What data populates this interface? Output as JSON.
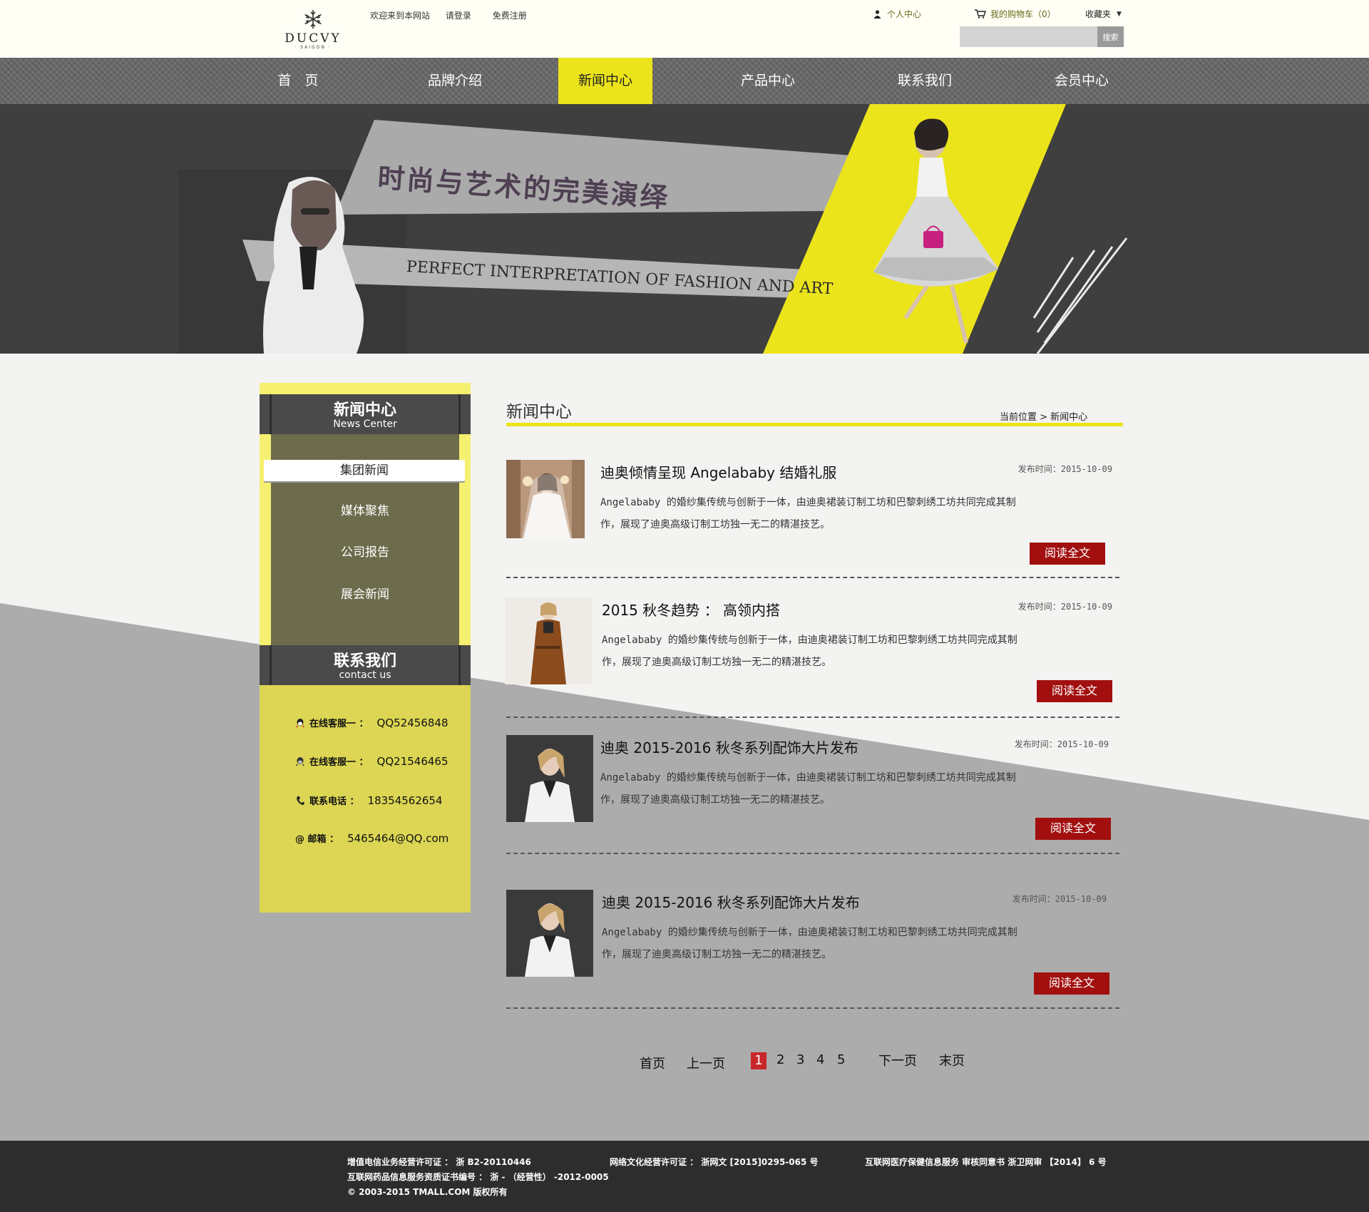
{
  "header": {
    "logo": {
      "brand": "DUCVY",
      "sub": "· SAIGON ·"
    },
    "welcome": "欢迎来到本网站",
    "login": "请登录",
    "register": "免费注册",
    "user_center": "个人中心",
    "cart": "我的购物车（0）",
    "favorites": "收藏夹",
    "search": {
      "placeholder": "",
      "button": "搜索"
    }
  },
  "nav": {
    "items": [
      {
        "label": "首　页"
      },
      {
        "label": "品牌介绍"
      },
      {
        "label": "新闻中心",
        "active": true
      },
      {
        "label": "产品中心"
      },
      {
        "label": "联系我们"
      },
      {
        "label": "会员中心"
      }
    ]
  },
  "banner": {
    "title": "时尚与艺术的完美演绎",
    "subtitle": "PERFECT INTERPRETATION OF FASHION AND ART"
  },
  "sidebar": {
    "news_head": {
      "title": "新闻中心",
      "subtitle": "News Center"
    },
    "menu": [
      {
        "label": "集团新闻",
        "active": true
      },
      {
        "label": "媒体聚焦"
      },
      {
        "label": "公司报告"
      },
      {
        "label": "展会新闻"
      }
    ],
    "contact_head": {
      "title": "联系我们",
      "subtitle": "contact us"
    },
    "contacts": [
      {
        "icon": "qq-icon",
        "label": "在线客服一 ：",
        "value": "QQ52456848"
      },
      {
        "icon": "qq-icon",
        "label": "在线客服一 ：",
        "value": "QQ21546465"
      },
      {
        "icon": "phone-icon",
        "label": "联系电话 ：",
        "value": "18354562654"
      },
      {
        "icon": "at-icon",
        "label": "@ 邮箱 ：",
        "value": "5465464@QQ.com"
      }
    ]
  },
  "content": {
    "title": "新闻中心",
    "breadcrumb": "当前位置 > 新闻中心",
    "news": [
      {
        "title": "迪奥倾情呈现 Angelababy 结婚礼服",
        "date": "发布时间：2015-10-09",
        "summary": "Angelababy 的婚纱集传统与创新于一体，由迪奥裙装订制工坊和巴黎刺绣工坊共同完成其制作，展现了迪奥高级订制工坊独一无二的精湛技艺。",
        "button": "阅读全文"
      },
      {
        "title": "2015 秋冬趋势 ： 高领内搭",
        "date": "发布时间：2015-10-09",
        "summary": "Angelababy 的婚纱集传统与创新于一体，由迪奥裙装订制工坊和巴黎刺绣工坊共同完成其制作，展现了迪奥高级订制工坊独一无二的精湛技艺。",
        "button": "阅读全文"
      },
      {
        "title": "迪奥 2015-2016 秋冬系列配饰大片发布",
        "date": "发布时间：2015-10-09",
        "summary": "Angelababy 的婚纱集传统与创新于一体，由迪奥裙装订制工坊和巴黎刺绣工坊共同完成其制作，展现了迪奥高级订制工坊独一无二的精湛技艺。",
        "button": "阅读全文"
      },
      {
        "title": "迪奥 2015-2016 秋冬系列配饰大片发布",
        "date": "发布时间：2015-10-09",
        "summary": "Angelababy 的婚纱集传统与创新于一体，由迪奥裙装订制工坊和巴黎刺绣工坊共同完成其制作，展现了迪奥高级订制工坊独一无二的精湛技艺。",
        "button": "阅读全文"
      }
    ]
  },
  "pagination": {
    "first": "首页",
    "prev": "上一页",
    "pages": [
      "1",
      "2",
      "3",
      "4",
      "5"
    ],
    "current": "1",
    "next": "下一页",
    "last": "末页"
  },
  "footer": {
    "license1": "增值电信业务经营许可证 ： 浙 B2-20110446",
    "license2": "网络文化经营许可证 ： 浙网文 [2015]0295-065 号",
    "license3": "互联网医疗保健信息服务 审核同意书 浙卫网审 【2014】 6 号",
    "license4": "互联网药品信息服务资质证书编号 ： 浙 - （经营性） -2012-0005",
    "copyright": "© 2003-2015 TMALL.COM 版权所有"
  },
  "colors": {
    "accent_yellow": "#ece41b",
    "button_red": "#a10f0f",
    "nav_gray": "#6a6a6a",
    "banner_bg": "#3f3f3f",
    "footer_bg": "#2d2d2d"
  }
}
